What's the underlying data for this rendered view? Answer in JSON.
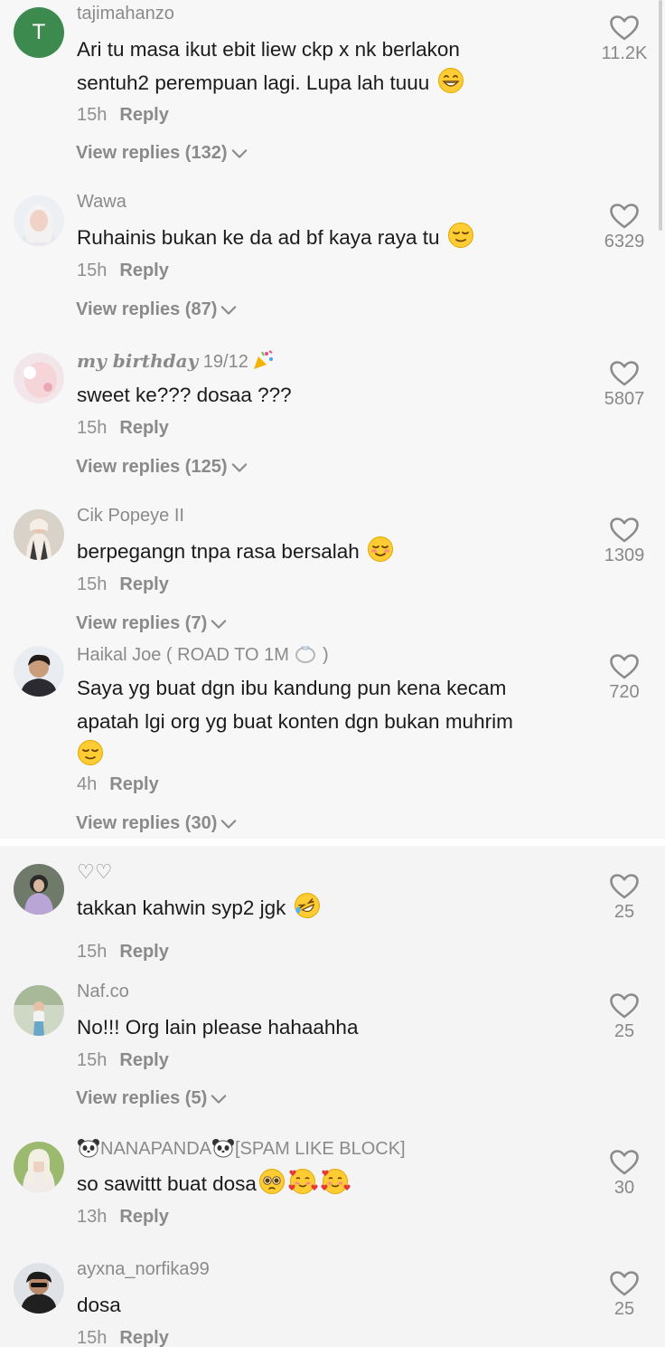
{
  "comments": [
    {
      "avatar_letter": "T",
      "username": "tajimahanzo",
      "text_lines": [
        "Ari tu masa ikut ebit liew ckp x nk berlakon",
        "sentuh2 perempuan lagi. Lupa lah tuuu"
      ],
      "time": "15h",
      "reply_label": "Reply",
      "view_replies": "View replies (132)",
      "likes": "11.2K"
    },
    {
      "username": "Wawa",
      "text_lines": [
        "Ruhainis bukan ke da ad bf kaya raya tu"
      ],
      "time": "15h",
      "reply_label": "Reply",
      "view_replies": "View replies (87)",
      "likes": "6329"
    },
    {
      "username_script": "my birthday",
      "username_rest": "19/12",
      "text_lines": [
        "sweet ke??? dosaa ???"
      ],
      "time": "15h",
      "reply_label": "Reply",
      "view_replies": "View replies (125)",
      "likes": "5807"
    },
    {
      "username": "Cik Popeye II",
      "text_lines": [
        "berpegangn tnpa rasa bersalah"
      ],
      "time": "15h",
      "reply_label": "Reply",
      "view_replies": "View replies (7)",
      "likes": "1309"
    },
    {
      "username": "Haikal Joe ( ROAD TO 1M",
      "username_suffix": " )",
      "text_lines": [
        "Saya yg buat dgn ibu kandung pun kena kecam",
        "apatah lgi org yg buat konten dgn bukan muhrim"
      ],
      "time": "4h",
      "reply_label": "Reply",
      "view_replies": "View replies (30)",
      "likes": "720"
    },
    {
      "username": "♡♡",
      "text_lines": [
        "takkan kahwin syp2 jgk"
      ],
      "time": "15h",
      "reply_label": "Reply",
      "likes": "25"
    },
    {
      "username": "Naf.co",
      "text_lines": [
        "No!!! Org lain please hahaahha"
      ],
      "time": "15h",
      "reply_label": "Reply",
      "view_replies": "View replies (5)",
      "likes": "25"
    },
    {
      "username": "NANAPANDA",
      "username_suffix": "[SPAM LIKE BLOCK]",
      "text_lines": [
        "so sawittt buat dosa"
      ],
      "time": "13h",
      "reply_label": "Reply",
      "likes": "30"
    },
    {
      "username": "ayxna_norfika99",
      "text_lines": [
        "dosa"
      ],
      "time": "15h",
      "reply_label": "Reply",
      "likes": "25"
    }
  ],
  "colors": {
    "accent_avatar": "#3d8a4f",
    "muted_text": "#8a8a8a",
    "body_text": "#1b1b1b"
  },
  "icons": [
    "heart-outline-icon",
    "chevron-down-icon",
    "grin-emoji",
    "relieved-emoji",
    "blush-emoji",
    "rofl-emoji",
    "pleading-emoji",
    "heart-face-emoji",
    "party-popper-emoji",
    "ring-emoji",
    "panda-emoji"
  ]
}
